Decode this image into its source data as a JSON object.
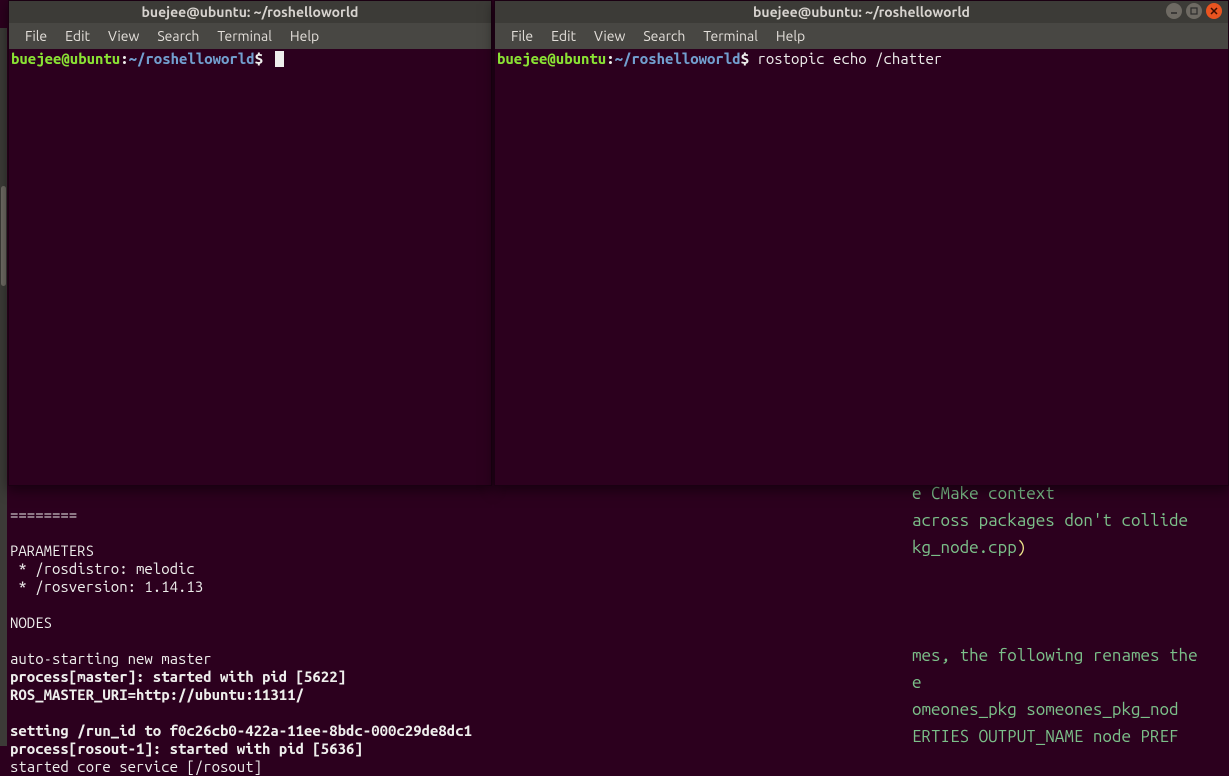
{
  "menus": {
    "file": "File",
    "edit": "Edit",
    "view": "View",
    "search": "Search",
    "terminal": "Terminal",
    "help": "Help"
  },
  "prompt": {
    "user_host": "buejee@ubuntu",
    "path": "~/roshelloworld",
    "dollar": "$"
  },
  "left_window": {
    "title": "buejee@ubuntu: ~/roshelloworld",
    "command": ""
  },
  "right_window": {
    "title": "buejee@ubuntu: ~/roshelloworld",
    "command": "rostopic echo /chatter"
  },
  "bg_roscore": {
    "sep": "========",
    "parameters_header": "PARAMETERS",
    "param1": " * /rosdistro: melodic",
    "param2": " * /rosversion: 1.14.13",
    "nodes_header": "NODES",
    "auto_start": "auto-starting new master",
    "proc_master": "process[master]: started with pid [5622]",
    "master_uri": "ROS_MASTER_URI=http://ubuntu:11311/",
    "set_runid": "setting /run_id to f0c26cb0-422a-11ee-8bdc-000c29de8dc1",
    "proc_rosout": "process[rosout-1]: started with pid [5636]",
    "started_core": "started core service [/rosout]"
  },
  "bg_editor": {
    "line1_a": "e CMake context",
    "line2_a": "across packages don't collide",
    "line3_a": "kg_node.cpp",
    "line3_paren": ")",
    "line4_a": "mes, the following renames the",
    "line5_a": "e",
    "line6_a": "omeones_pkg someones_pkg_nod",
    "line7_a": "ERTIES OUTPUT_NAME node PREF"
  }
}
